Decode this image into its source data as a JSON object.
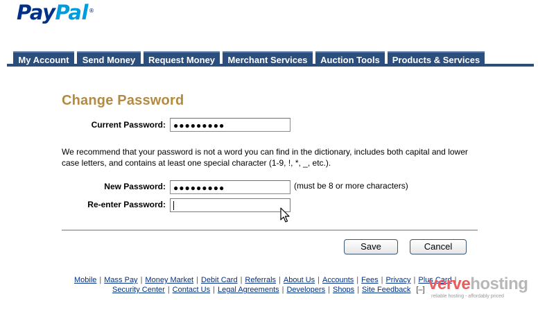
{
  "logo": {
    "part1": "Pay",
    "part2": "Pal",
    "tm": "®"
  },
  "nav": {
    "tabs": [
      {
        "label": "My Account"
      },
      {
        "label": "Send Money"
      },
      {
        "label": "Request Money"
      },
      {
        "label": "Merchant Services"
      },
      {
        "label": "Auction Tools"
      },
      {
        "label": "Products & Services"
      }
    ]
  },
  "form": {
    "title": "Change Password",
    "current_label": "Current Password:",
    "current_value": "●●●●●●●●●",
    "recommendation": "We recommend that your password is not a word you can find in the dictionary, includes both capital and lower case letters, and contains at least one special character (1-9, !, *, _, etc.).",
    "new_label": "New Password:",
    "new_value": "●●●●●●●●●",
    "new_hint": "(must be 8 or more characters)",
    "reenter_label": "Re-enter Password:",
    "reenter_value": "",
    "save_label": "Save",
    "cancel_label": "Cancel"
  },
  "footer": {
    "row1": [
      "Mobile",
      "Mass Pay",
      "Money Market",
      "Debit Card",
      "Referrals",
      "About Us",
      "Accounts",
      "Fees",
      "Privacy",
      "Plus Card"
    ],
    "row2": [
      "Security Center",
      "Contact Us",
      "Legal Agreements",
      "Developers",
      "Shops",
      "Site Feedback"
    ],
    "row2_suffix": "[–]"
  },
  "watermark": {
    "word1": "verve",
    "word2": "hosting",
    "tagline": "reliable hosting - affordably priced"
  },
  "icons": {
    "cursor": "mouse-pointer-icon"
  }
}
